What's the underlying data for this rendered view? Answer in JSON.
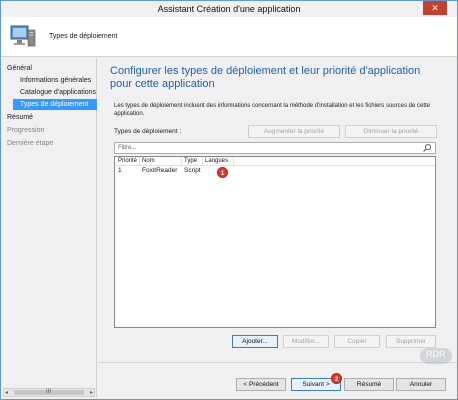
{
  "window": {
    "title": "Assistant Création d'une application",
    "close_glyph": "✕"
  },
  "header": {
    "icon": "computer-icon",
    "title": "Types de déploiement"
  },
  "sidebar": {
    "items": [
      {
        "label": "Général",
        "level": "top",
        "state": "normal"
      },
      {
        "label": "Informations générales",
        "level": "sub",
        "state": "normal"
      },
      {
        "label": "Catalogue d'applications",
        "level": "sub",
        "state": "normal"
      },
      {
        "label": "Types de déploiement",
        "level": "sub",
        "state": "active"
      },
      {
        "label": "Résumé",
        "level": "top",
        "state": "normal"
      },
      {
        "label": "Progression",
        "level": "top",
        "state": "muted"
      },
      {
        "label": "Dernière étape",
        "level": "top",
        "state": "muted"
      }
    ],
    "scroll_grip": "III"
  },
  "content": {
    "title": "Configurer les types de déploiement et leur priorité d'application pour cette application",
    "description": "Les types de déploiement incluent des informations concernant la méthode d'installation et les fichiers sources de cette application.",
    "types_label": "Types de déploiement :",
    "increase_priority": "Augmenter la priorité",
    "decrease_priority": "Diminuer la priorité",
    "filter_placeholder": "Filtre...",
    "columns": [
      "Priorité",
      "Nom",
      "Type",
      "Langues"
    ],
    "rows": [
      {
        "priority": "1",
        "name": "FoxitReader",
        "type": "Script",
        "languages": ""
      }
    ],
    "add_button": "Ajouter...",
    "modify_button": "Modifier...",
    "copy_button": "Copier",
    "delete_button": "Supprimer"
  },
  "footer": {
    "prev_button": "< Précédent",
    "next_button": "Suivant >",
    "summary_button": "Résumé",
    "cancel_button": "Annuler"
  },
  "annotations": {
    "badge_1": "1",
    "badge_2": "2"
  },
  "watermark": {
    "text": "RDR",
    "icon": "rdr-logo-watermark"
  },
  "colors": {
    "accent_blue": "#1e5fa8",
    "selection": "#3399ff",
    "badge_red": "#e03a2f",
    "close_red": "#c7402d"
  }
}
